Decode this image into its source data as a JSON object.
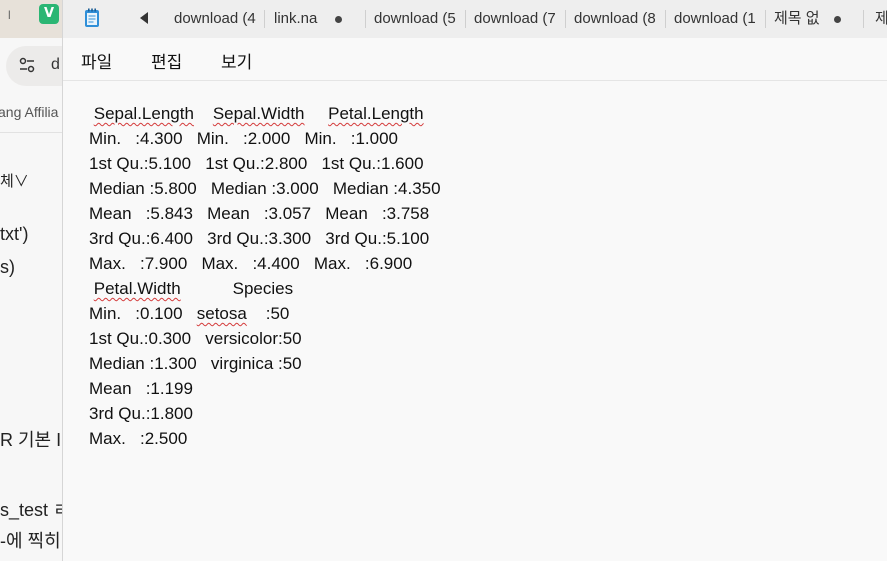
{
  "background_browser": {
    "tab_fragment": "l",
    "favicon_letter": "V",
    "search_text": "d",
    "bookmark_text": "ang Affilia",
    "text_lines": [
      "체∨",
      "txt')",
      "s)",
      "R 기본 I",
      "s_test ㄹ",
      "-에 찍히"
    ]
  },
  "notepad": {
    "tabs": [
      {
        "label": "download (4",
        "modified": false
      },
      {
        "label": "link.na",
        "modified": true
      },
      {
        "label": "download (5",
        "modified": false
      },
      {
        "label": "download (7",
        "modified": false
      },
      {
        "label": "download (8",
        "modified": false
      },
      {
        "label": "download (1",
        "modified": false
      },
      {
        "label": "제목 없",
        "modified": true
      },
      {
        "label": "제",
        "modified": false
      }
    ],
    "menu": [
      "파일",
      "편집",
      "보기"
    ],
    "content": {
      "line1": [
        "Sepal.Length",
        "Sepal.Width",
        "Petal.Length"
      ],
      "line2": "Min.   :4.300   Min.   :2.000   Min.   :1.000",
      "line3": "1st Qu.:5.100   1st Qu.:2.800   1st Qu.:1.600",
      "line4": "Median :5.800   Median :3.000   Median :4.350",
      "line5": "Mean   :5.843   Mean   :3.057   Mean   :3.758",
      "line6": "3rd Qu.:6.400   3rd Qu.:3.300   3rd Qu.:5.100",
      "line7": "Max.   :7.900   Max.   :4.400   Max.   :6.900",
      "line8": [
        "Petal.Width",
        "Species"
      ],
      "line9": [
        "Min.   :0.100   ",
        "setosa",
        "    :50"
      ],
      "line10": "1st Qu.:0.300   versicolor:50",
      "line11": "Median :1.300   virginica :50",
      "line12": "Mean   :1.199",
      "line13": "3rd Qu.:1.800",
      "line14": "Max.   :2.500"
    }
  }
}
